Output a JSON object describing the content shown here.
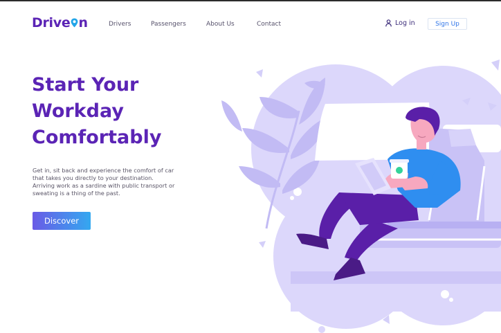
{
  "brand": {
    "name": "Driveon",
    "prefix": "Drive",
    "suffix": "n",
    "pin_color": "#22a5e8"
  },
  "nav": {
    "links": [
      {
        "label": "Drivers"
      },
      {
        "label": "Passengers"
      },
      {
        "label": "About Us"
      },
      {
        "label": "Contact"
      }
    ],
    "login_label": "Log in",
    "login_icon": "user-icon",
    "signup_label": "Sign Up"
  },
  "hero": {
    "headline_lines": [
      "Start Your",
      "Workday",
      "Comfortably"
    ],
    "description_lines": [
      "Get in, sit back and experience the comfort of car",
      "that takes you directly to your destination.",
      "Arriving work as a sardine with public transport or",
      "sweating is a thing of the past."
    ],
    "cta_label": "Discover"
  },
  "colors": {
    "brand_purple": "#5b24b5",
    "accent_blue": "#2e74e8",
    "cta_gradient_start": "#6a5be6",
    "cta_gradient_end": "#34a8f0",
    "illustration_lavender": "#d9d4fb",
    "shirt_blue": "#2f8ef0"
  }
}
